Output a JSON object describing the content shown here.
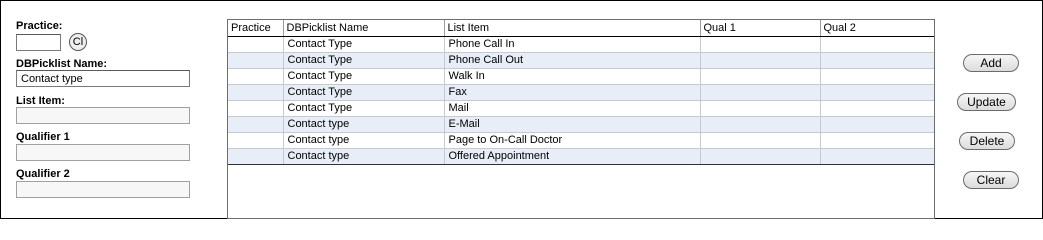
{
  "form": {
    "practice_label": "Practice:",
    "practice_value": "",
    "cl_button": "Cl",
    "dbpicklist_label": "DBPicklist Name:",
    "dbpicklist_value": "Contact type",
    "list_item_label": "List Item:",
    "list_item_value": "",
    "qualifier1_label": "Qualifier 1",
    "qualifier1_value": "",
    "qualifier2_label": "Qualifier 2",
    "qualifier2_value": ""
  },
  "grid": {
    "columns": [
      "Practice",
      "DBPicklist Name",
      "List Item",
      "Qual 1",
      "Qual 2"
    ],
    "rows": [
      [
        "",
        "Contact Type",
        "Phone Call In",
        "",
        ""
      ],
      [
        "",
        "Contact Type",
        "Phone Call Out",
        "",
        ""
      ],
      [
        "",
        "Contact Type",
        "Walk In",
        "",
        ""
      ],
      [
        "",
        "Contact Type",
        "Fax",
        "",
        ""
      ],
      [
        "",
        "Contact Type",
        "Mail",
        "",
        ""
      ],
      [
        "",
        "Contact type",
        "E-Mail",
        "",
        ""
      ],
      [
        "",
        "Contact type",
        "Page to On-Call Doctor",
        "",
        ""
      ],
      [
        "",
        "Contact type",
        "Offered Appointment",
        "",
        ""
      ]
    ]
  },
  "actions": {
    "add": "Add",
    "update": "Update",
    "delete": "Delete",
    "clear": "Clear"
  }
}
